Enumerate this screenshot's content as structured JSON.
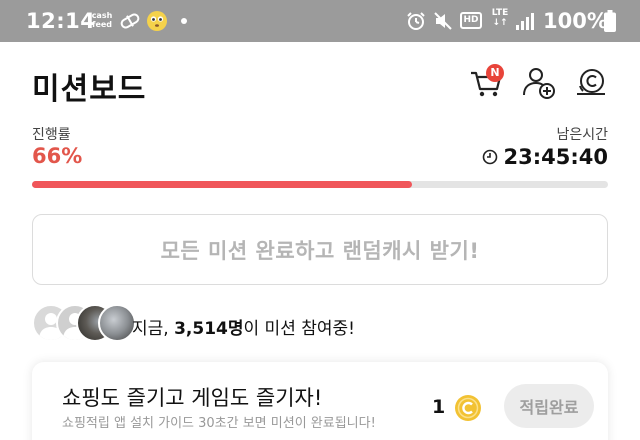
{
  "status_bar": {
    "time": "12:14",
    "cashfeed": "cash feed",
    "lte": "LTE",
    "hd": "HD",
    "battery": "100%",
    "icons": [
      "cashfeed-icon",
      "pill-icon",
      "emoji-icon",
      "alarm-icon",
      "mute-icon",
      "hd-icon",
      "lte-icon",
      "signal-icon",
      "battery-icon"
    ]
  },
  "header": {
    "title": "미션보드",
    "cart_badge": "N",
    "icons": [
      "cart-icon",
      "add-friend-icon",
      "coin-history-icon"
    ]
  },
  "progress": {
    "label": "진행률",
    "value_text": "66%",
    "fraction": 0.66,
    "remaining_label": "남은시간",
    "remaining_time": "23:45:40",
    "bar_color": "#f0565a"
  },
  "reward": {
    "text": "모든 미션 완료하고 랜덤캐시 받기!"
  },
  "participants": {
    "prefix": "지금, ",
    "count": "3,514명",
    "suffix": "이 미션 참여중!"
  },
  "mission": {
    "title": "쇼핑도 즐기고 게임도 즐기자!",
    "subtitle": "쇼핑적립 앱 설치 가이드 30초간 보면 미션이 완료됩니다!",
    "reward_count": "1",
    "button_label": "적립완료"
  },
  "colors": {
    "accent": "#e2564b",
    "status_bar": "#9b9b9b",
    "coin": "#f2c233"
  }
}
